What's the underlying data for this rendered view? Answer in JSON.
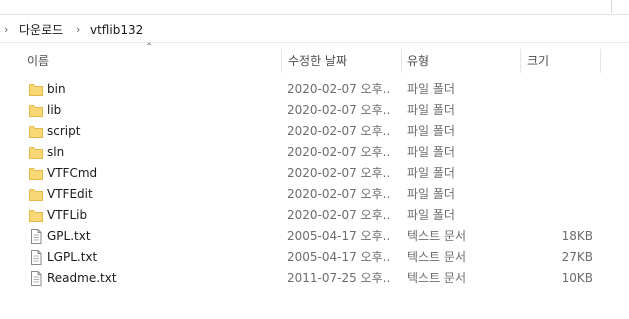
{
  "breadcrumb": {
    "items": [
      "다운로드",
      "vtflib132"
    ],
    "separator": "›"
  },
  "columns": {
    "name": "이름",
    "date": "수정한 날짜",
    "type": "유형",
    "size": "크기"
  },
  "colors": {
    "folder": "#F8D775",
    "folder_dark": "#E5B84B",
    "doc_border": "#8a8a8a"
  },
  "files": [
    {
      "name": "bin",
      "date": "2020-02-07 오후...",
      "type": "파일 폴더",
      "size": "",
      "icon": "folder-icon"
    },
    {
      "name": "lib",
      "date": "2020-02-07 오후...",
      "type": "파일 폴더",
      "size": "",
      "icon": "folder-icon"
    },
    {
      "name": "script",
      "date": "2020-02-07 오후...",
      "type": "파일 폴더",
      "size": "",
      "icon": "folder-icon"
    },
    {
      "name": "sln",
      "date": "2020-02-07 오후...",
      "type": "파일 폴더",
      "size": "",
      "icon": "folder-icon"
    },
    {
      "name": "VTFCmd",
      "date": "2020-02-07 오후...",
      "type": "파일 폴더",
      "size": "",
      "icon": "folder-icon"
    },
    {
      "name": "VTFEdit",
      "date": "2020-02-07 오후...",
      "type": "파일 폴더",
      "size": "",
      "icon": "folder-icon"
    },
    {
      "name": "VTFLib",
      "date": "2020-02-07 오후...",
      "type": "파일 폴더",
      "size": "",
      "icon": "folder-icon"
    },
    {
      "name": "GPL.txt",
      "date": "2005-04-17 오후...",
      "type": "텍스트 문서",
      "size": "18KB",
      "icon": "text-file-icon"
    },
    {
      "name": "LGPL.txt",
      "date": "2005-04-17 오후...",
      "type": "텍스트 문서",
      "size": "27KB",
      "icon": "text-file-icon"
    },
    {
      "name": "Readme.txt",
      "date": "2011-07-25 오후...",
      "type": "텍스트 문서",
      "size": "10KB",
      "icon": "text-file-icon"
    }
  ]
}
